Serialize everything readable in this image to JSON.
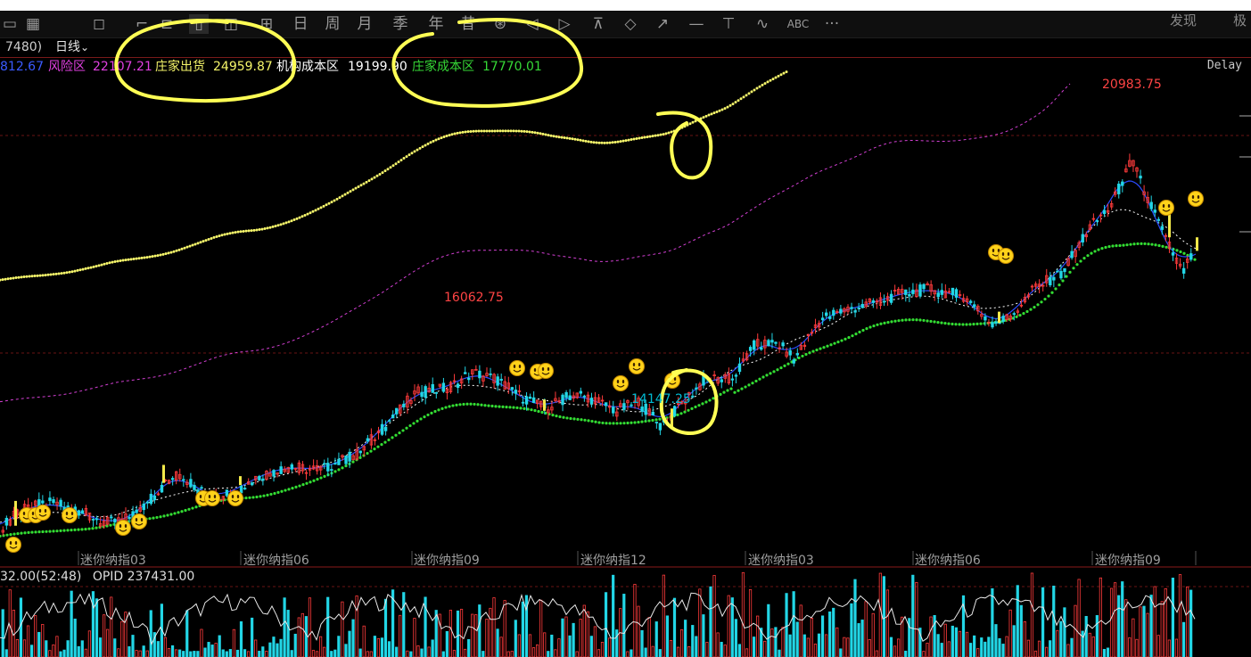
{
  "toolbar": {
    "icons": [
      "screen-icon",
      "layout-icon",
      "draw-icon",
      "line-icon",
      "minute-chart-icon",
      "candle-icon",
      "30min-icon",
      "60min-icon",
      "day-icon",
      "week-icon",
      "month-icon",
      "quarter-icon",
      "year-icon",
      "multi-period-icon",
      "settings-icon",
      "arrow-left-icon",
      "arrow-right-icon",
      "fibonacci-icon",
      "diamond-icon",
      "ray-icon",
      "horizontal-line-icon",
      "vertical-line-icon",
      "wave-icon"
    ],
    "period_labels": [
      "周",
      "月",
      "季",
      "年",
      "昔"
    ],
    "text_tool": "ABC",
    "more": "···",
    "right_items": [
      "发现",
      "极"
    ]
  },
  "infobar": {
    "code_fragment": "7480)",
    "period": "日线"
  },
  "legend": {
    "first_value": "812.67",
    "risk_label": "风险区",
    "risk_value": "22107.21",
    "dealer_out_label": "庄家出货",
    "dealer_out_value": "24959.87",
    "inst_cost_label": "机构成本区",
    "inst_cost_value": "19199.90",
    "dealer_cost_label": "庄家成本区",
    "dealer_cost_value": "17770.01",
    "delay": "Delay",
    "colors": {
      "first": "#3b5bff",
      "risk": "#e040e0",
      "dealer_out": "#f5f56a",
      "inst_cost": "#ffffff",
      "dealer_cost": "#36d936"
    }
  },
  "annotations": {
    "peak1": "16062.75",
    "peak2": "20983.75",
    "low1": "14147.25"
  },
  "xaxis": {
    "labels": [
      "迷你纳指03",
      "迷你纳指06",
      "迷你纳指09",
      "迷你纳指12",
      "迷你纳指03",
      "迷你纳指06",
      "迷你纳指09"
    ]
  },
  "volume": {
    "label_a": "32.00(52:48)",
    "label_b": "OPID 237431.00"
  },
  "chart_data": {
    "type": "line",
    "instrument": "迷你纳指",
    "period": "日线",
    "x": [
      "迷你纳指03",
      "迷你纳指06",
      "迷你纳指09",
      "迷你纳指12",
      "迷你纳指03",
      "迷你纳指06",
      "迷你纳指09"
    ],
    "series": [
      {
        "name": "风险区",
        "values": [
          15300,
          17100,
          19200,
          19900,
          20500,
          21400,
          22107.21
        ]
      },
      {
        "name": "庄家出货",
        "values": [
          17600,
          20000,
          22700,
          23400,
          24959.87
        ]
      },
      {
        "name": "机构成本区",
        "values": [
          12300,
          13100,
          14600,
          15000,
          16800,
          18300,
          19199.9
        ]
      },
      {
        "name": "庄家成本区",
        "values": [
          12150,
          12700,
          14000,
          14200,
          15800,
          17100,
          17770.01
        ]
      }
    ],
    "price_approx": [
      12500,
      13400,
      15300,
      14900,
      17000,
      18800,
      19400
    ],
    "annotations": {
      "high1": 16062.75,
      "low1": 14147.25,
      "high2": 20983.75
    },
    "ylim": [
      11900,
      22800
    ]
  }
}
